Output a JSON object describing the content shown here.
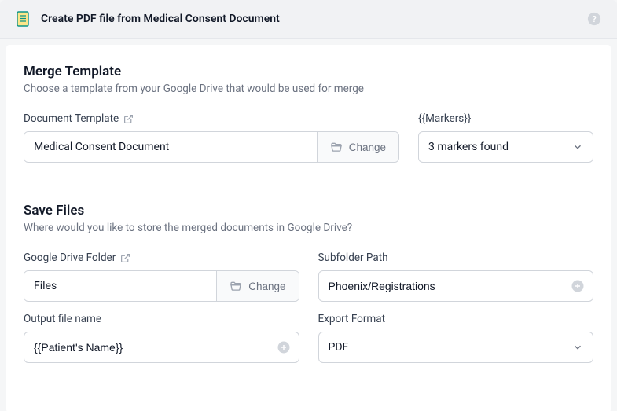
{
  "header": {
    "title": "Create PDF file from Medical Consent Document"
  },
  "merge": {
    "title": "Merge Template",
    "desc": "Choose a template from your Google Drive that would be used for merge",
    "template_label": "Document Template",
    "template_value": "Medical Consent Document",
    "change_label": "Change",
    "markers_label": "{{Markers}}",
    "markers_value": "3 markers found"
  },
  "save": {
    "title": "Save Files",
    "desc": "Where would you like to store the merged documents in Google Drive?",
    "folder_label": "Google Drive Folder",
    "folder_value": "Files",
    "folder_change_label": "Change",
    "subfolder_label": "Subfolder Path",
    "subfolder_value": "Phoenix/Registrations",
    "output_label": "Output file name",
    "output_value": "{{Patient's Name}}",
    "format_label": "Export Format",
    "format_value": "PDF"
  }
}
